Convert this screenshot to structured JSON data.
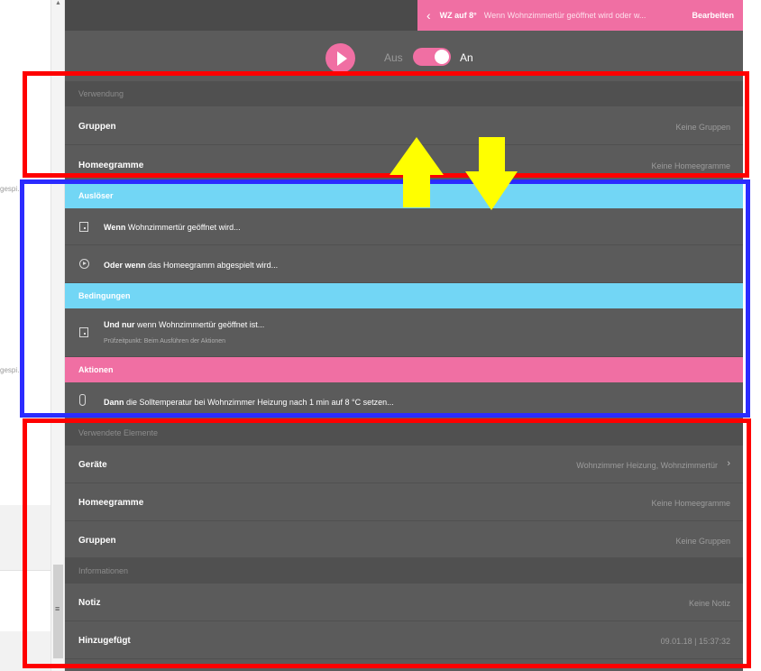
{
  "background": {
    "fragment_1": "gespi…",
    "fragment_2": "gespi…"
  },
  "header": {
    "back_icon": "chevron-left-icon",
    "title": "WZ auf 8°",
    "description": "Wenn Wohnzimmertür geöffnet wird oder w...",
    "edit_label": "Bearbeiten"
  },
  "controls": {
    "play_icon": "play-icon",
    "off_label": "Aus",
    "on_label": "An",
    "enabled": true
  },
  "verwendung": {
    "heading": "Verwendung",
    "rows": [
      {
        "label": "Gruppen",
        "value": "Keine Gruppen"
      },
      {
        "label": "Homeegramme",
        "value": "Keine Homeegramme"
      }
    ]
  },
  "ausloeser": {
    "heading": "Auslöser",
    "rules": [
      {
        "icon": "door-icon",
        "keyword": "Wenn",
        "text": "Wohnzimmertür geöffnet wird..."
      },
      {
        "icon": "play-circle-icon",
        "keyword": "Oder wenn",
        "text": "das Homeegramm abgespielt wird..."
      }
    ]
  },
  "bedingungen": {
    "heading": "Bedingungen",
    "rules": [
      {
        "icon": "door-icon",
        "keyword": "Und nur",
        "text": "wenn Wohnzimmertür geöffnet ist...",
        "sub": "Prüfzeitpunkt: Beim Ausführen der Aktionen"
      }
    ]
  },
  "aktionen": {
    "heading": "Aktionen",
    "rules": [
      {
        "icon": "thermometer-icon",
        "keyword": "Dann",
        "text": "die Solltemperatur bei Wohnzimmer Heizung nach 1 min auf 8 °C setzen..."
      }
    ]
  },
  "verwendete_elemente": {
    "heading": "Verwendete Elemente",
    "rows": [
      {
        "label": "Geräte",
        "value": "Wohnzimmer Heizung, Wohnzimmertür",
        "chevron": "›"
      },
      {
        "label": "Homeegramme",
        "value": "Keine Homeegramme"
      },
      {
        "label": "Gruppen",
        "value": "Keine Gruppen"
      }
    ]
  },
  "informationen": {
    "heading": "Informationen",
    "rows": [
      {
        "label": "Notiz",
        "value": "Keine Notiz"
      },
      {
        "label": "Hinzugefügt",
        "value": "09.01.18 | 15:37:32"
      }
    ]
  },
  "annotations": {
    "arrow_up_color": "#ffff00",
    "arrow_down_color": "#ffff00",
    "box_red_color": "#ff0000",
    "box_blue_color": "#2b2bff"
  }
}
